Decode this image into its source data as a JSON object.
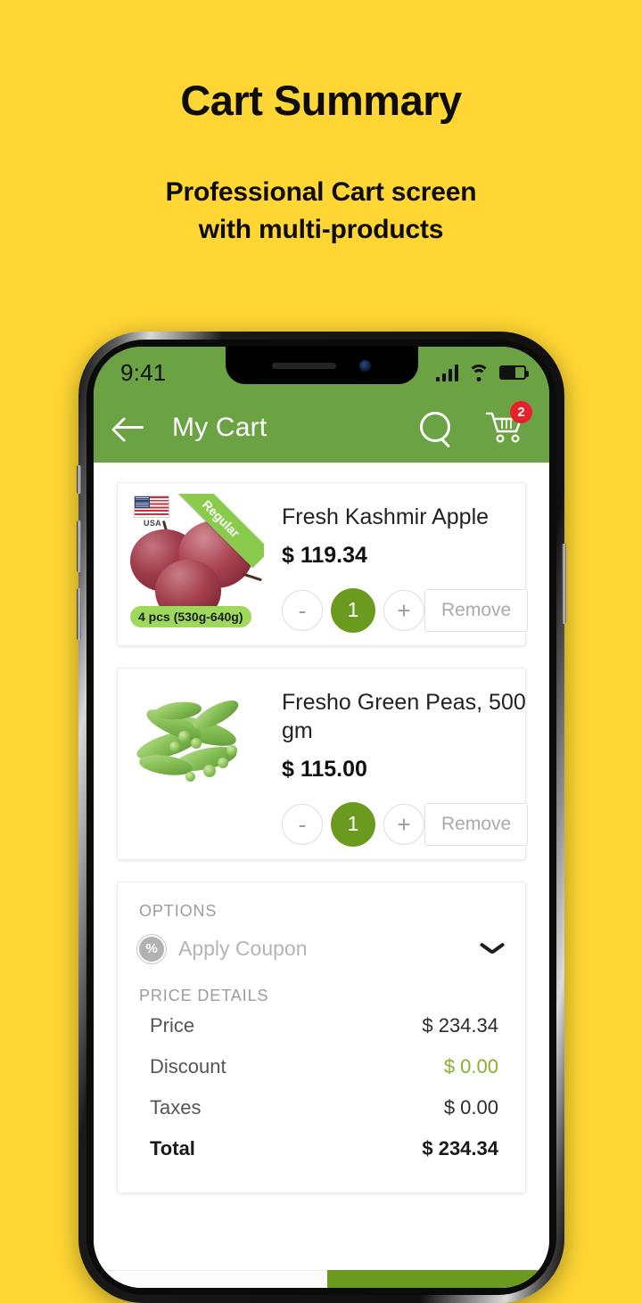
{
  "promo": {
    "title": "Cart Summary",
    "subtitle_line1": "Professional Cart screen",
    "subtitle_line2": "with multi-products"
  },
  "status_bar": {
    "time": "9:41",
    "signal_icon": "signal-bars-icon",
    "wifi_icon": "wifi-icon",
    "battery_icon": "battery-icon"
  },
  "app_bar": {
    "back_icon": "back-arrow-icon",
    "title": "My Cart",
    "search_icon": "search-icon",
    "cart_icon": "shopping-cart-icon",
    "cart_badge_count": "2"
  },
  "products": [
    {
      "name": "Fresh Kashmir Apple",
      "price": "$ 119.34",
      "ribbon": "Regular",
      "origin_label": "USA",
      "weight_badge": "4 pcs (530g-640g)",
      "qty": "1",
      "decrement_label": "-",
      "increment_label": "+",
      "remove_label": "Remove"
    },
    {
      "name": "Fresho Green Peas, 500 gm",
      "price": "$ 115.00",
      "qty": "1",
      "decrement_label": "-",
      "increment_label": "+",
      "remove_label": "Remove"
    }
  ],
  "options": {
    "section_label": "OPTIONS",
    "coupon_icon": "percent-badge-icon",
    "coupon_label": "Apply Coupon",
    "expand_icon": "chevron-down-icon"
  },
  "price_details": {
    "section_label": "PRICE DETAILS",
    "rows": [
      {
        "label": "Price",
        "value": "$ 234.34"
      },
      {
        "label": "Discount",
        "value": "$ 0.00"
      },
      {
        "label": "Taxes",
        "value": "$ 0.00"
      },
      {
        "label": "Total",
        "value": "$ 234.34"
      }
    ]
  },
  "colors": {
    "background": "#FFD633",
    "header_green": "#6BA243",
    "accent_green": "#6B9B1E",
    "badge_red": "#E8202A",
    "discount_green": "#8AAF2E"
  }
}
